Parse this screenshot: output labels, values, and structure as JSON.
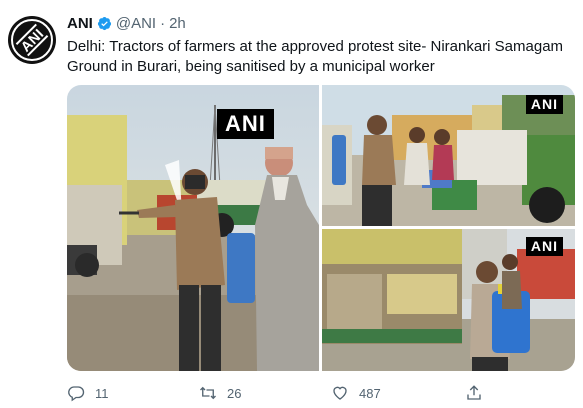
{
  "tweet": {
    "author": "ANI",
    "handle": "@ANI",
    "separator": "·",
    "time": "2h",
    "avatar_text": "ANI",
    "text": "Delhi: Tractors of farmers at the approved protest site- Nirankari Samagam Ground in Burari, being sanitised by a municipal worker",
    "photos": [
      {
        "watermark": "ANI"
      },
      {
        "watermark": "ANI"
      },
      {
        "watermark": "ANI"
      }
    ],
    "actions": {
      "reply_count": "11",
      "retweet_count": "26",
      "like_count": "487"
    }
  },
  "colors": {
    "verified": "#1d9bf0",
    "muted": "#536471",
    "text": "#0f1419"
  },
  "icons": [
    "verified-icon",
    "reply-icon",
    "retweet-icon",
    "like-icon",
    "share-icon"
  ]
}
